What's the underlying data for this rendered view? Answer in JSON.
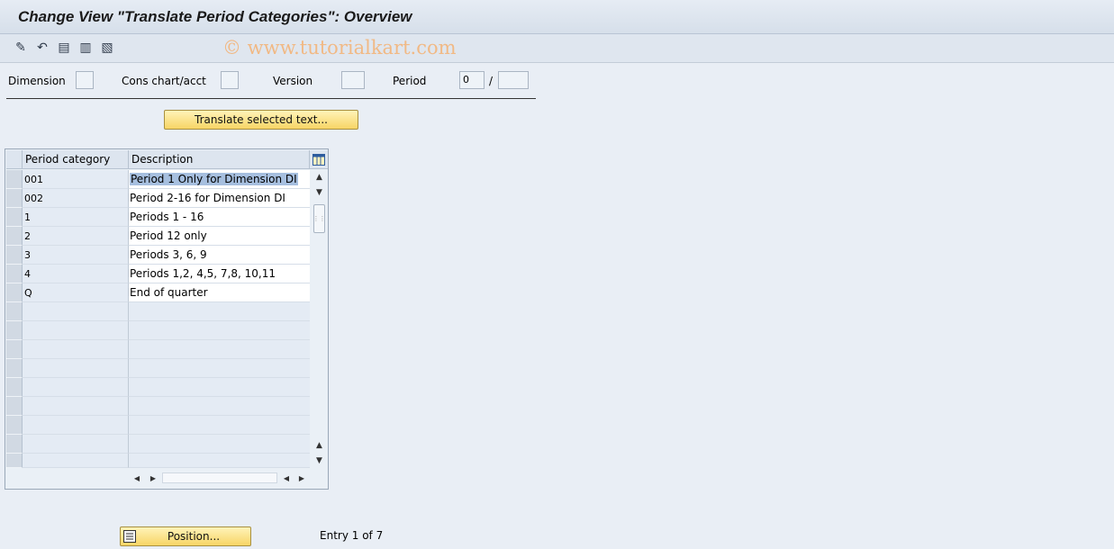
{
  "title": "Change View \"Translate Period Categories\": Overview",
  "watermark": "© www.tutorialkart.com",
  "toolbar": {
    "icons": [
      "display-change-icon",
      "undo-icon",
      "select-all-icon",
      "select-block-icon",
      "deselect-all-icon"
    ]
  },
  "selection": {
    "dimension_label": "Dimension",
    "dimension_value": "",
    "cons_chart_label": "Cons chart/acct",
    "cons_chart_value": "",
    "version_label": "Version",
    "version_value": "",
    "period_label": "Period",
    "period_from": "0",
    "period_sep": "/",
    "period_to": ""
  },
  "translate_button": "Translate selected text...",
  "table": {
    "columns": [
      "Period category",
      "Description"
    ],
    "rows": [
      {
        "cat": "001",
        "desc": "Period 1 Only for Dimension DI"
      },
      {
        "cat": "002",
        "desc": "Period 2-16 for Dimension DI"
      },
      {
        "cat": "1",
        "desc": "Periods 1 - 16"
      },
      {
        "cat": "2",
        "desc": "Period 12 only"
      },
      {
        "cat": "3",
        "desc": "Periods 3, 6, 9"
      },
      {
        "cat": "4",
        "desc": "Periods 1,2, 4,5, 7,8, 10,11"
      },
      {
        "cat": "Q",
        "desc": "End of quarter"
      }
    ]
  },
  "position_button": "Position...",
  "entry_text": "Entry 1 of 7"
}
